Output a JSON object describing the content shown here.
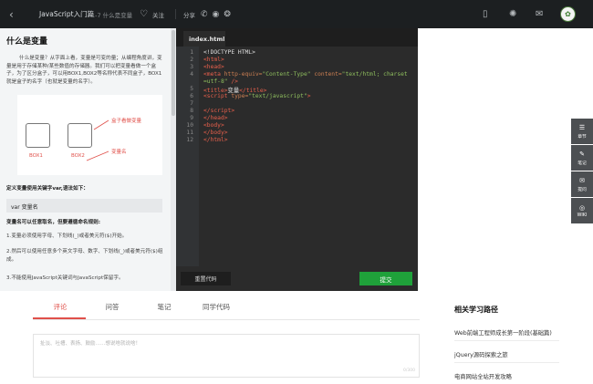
{
  "topbar": {
    "back": "‹",
    "course": "JavaScript入门篇",
    "lesson": "1-7 什么是变量",
    "follow": "关注",
    "share": "分享"
  },
  "lesson": {
    "title": "什么是变量",
    "para1": "什么是变量？从字面上看，变量是可变的量；从编程角度讲，变量是用于存储某种/某些数值的存储器。我们可以把变量看做一个盒子，为了区分盒子，可以用BOX1,BOX2等名称代表不同盒子，BOX1就是盒子的名字（也就是变量的名字）。",
    "fig_label_value": "盒子看做变量",
    "fig_label_name": "变量名",
    "box1": "BOX1",
    "box2": "BOX2",
    "define_text": "定义变量使用关键字var,语法如下：",
    "code": "var 变量名",
    "rules_title": "变量名可以任意取名，但要遵循命名规则:",
    "rule1": "1.变量必须使用字母、下划线(_)或者美元符($)开始。",
    "rule2": "2.然后可以使用任意多个英文字母、数字、下划线(_)或者美元符($)组成。",
    "rule3": "3.不能使用JavaScript关键词与JavaScript保留字。"
  },
  "editor": {
    "tab": "index.html",
    "reset": "重置代码",
    "submit": "提交",
    "lines": [
      "1",
      "2",
      "3",
      "4",
      "5",
      "6",
      "7",
      "8",
      "9",
      "10",
      "11",
      "12"
    ]
  },
  "tools": [
    "章节",
    "笔记",
    "提问",
    "WIKI"
  ],
  "bottom": {
    "tabs": [
      "评论",
      "问答",
      "笔记",
      "同学代码"
    ],
    "placeholder": "扯淡、吐槽、表扬、鼓励……想说啥就说啥！",
    "count": "0/300"
  },
  "related": {
    "title": "相关学习路径",
    "items": [
      "Web前端工程师成长第一阶段(基础篇)",
      "jQuery源码探索之旅",
      "电商网站全站开发攻略"
    ]
  }
}
